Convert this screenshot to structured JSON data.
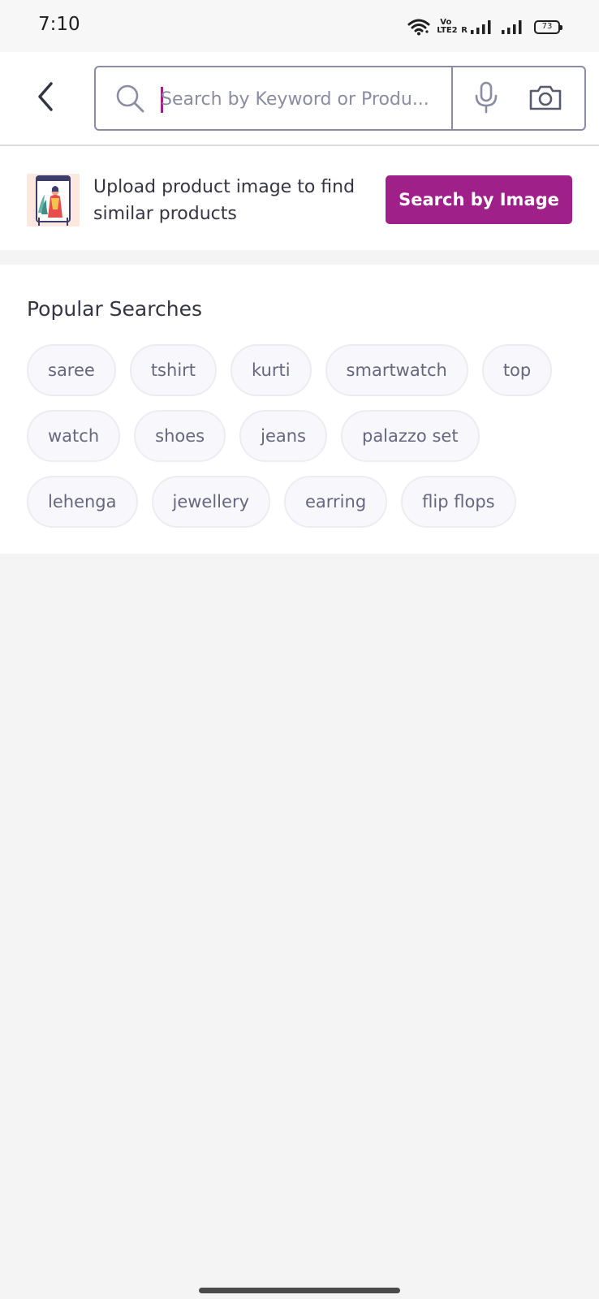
{
  "status_bar": {
    "time": "7:10",
    "volte_line1": "Vo",
    "volte_line2": "LTE2",
    "roaming": "R",
    "battery": "73"
  },
  "search": {
    "placeholder": "Search by Keyword or Produ...",
    "value": ""
  },
  "image_banner": {
    "text": "Upload product image to find similar products",
    "button_label": "Search by Image"
  },
  "popular": {
    "title": "Popular Searches",
    "items": [
      "saree",
      "tshirt",
      "kurti",
      "smartwatch",
      "top",
      "watch",
      "shoes",
      "jeans",
      "palazzo set",
      "lehenga",
      "jewellery",
      "earring",
      "flip flops"
    ]
  },
  "colors": {
    "accent": "#9f2089",
    "chip_background": "#f8f8fc",
    "chip_border": "#ececf2",
    "chip_text": "#666680",
    "text_primary": "#353543",
    "placeholder": "#8b8ba3",
    "page_background": "#f4f4f5"
  },
  "icons": {
    "back": "chevron-left-icon",
    "search": "search-icon",
    "mic": "microphone-icon",
    "camera": "camera-icon",
    "wifi": "wifi-icon",
    "signal": "signal-icon",
    "battery": "battery-icon"
  }
}
